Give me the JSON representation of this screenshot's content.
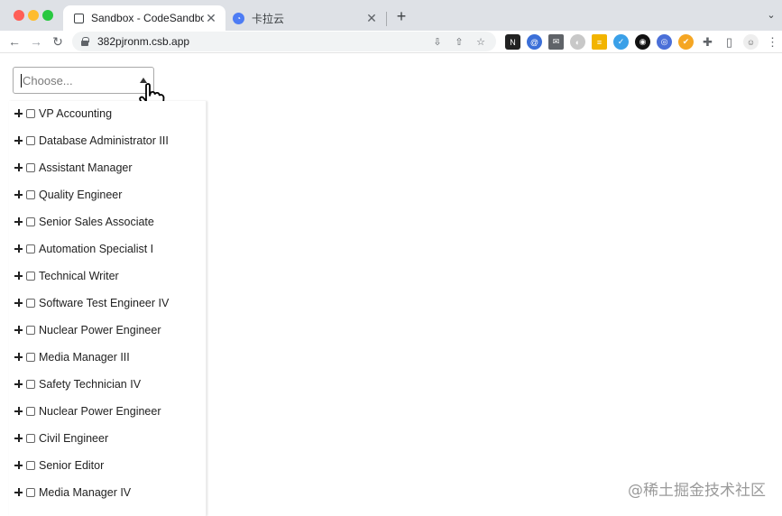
{
  "browser": {
    "tabs": [
      {
        "title": "Sandbox - CodeSandbox",
        "active": true,
        "icon": "codesandbox-icon"
      },
      {
        "title": "卡拉云",
        "active": false,
        "icon": "kalayun-icon"
      }
    ],
    "url": "382pjronm.csb.app"
  },
  "select": {
    "placeholder": "Choose..."
  },
  "tree": {
    "items": [
      {
        "label": "VP Accounting"
      },
      {
        "label": "Database Administrator III"
      },
      {
        "label": "Assistant Manager"
      },
      {
        "label": "Quality Engineer"
      },
      {
        "label": "Senior Sales Associate"
      },
      {
        "label": "Automation Specialist I"
      },
      {
        "label": "Technical Writer"
      },
      {
        "label": "Software Test Engineer IV"
      },
      {
        "label": "Nuclear Power Engineer"
      },
      {
        "label": "Media Manager III"
      },
      {
        "label": "Safety Technician IV"
      },
      {
        "label": "Nuclear Power Engineer"
      },
      {
        "label": "Civil Engineer"
      },
      {
        "label": "Senior Editor"
      },
      {
        "label": "Media Manager IV"
      }
    ]
  },
  "watermark": "@稀土掘金技术社区",
  "colors": {
    "tabbar_bg": "#dee1e6",
    "omnibox_bg": "#f1f3f4",
    "select_border": "#aaaaaa"
  }
}
